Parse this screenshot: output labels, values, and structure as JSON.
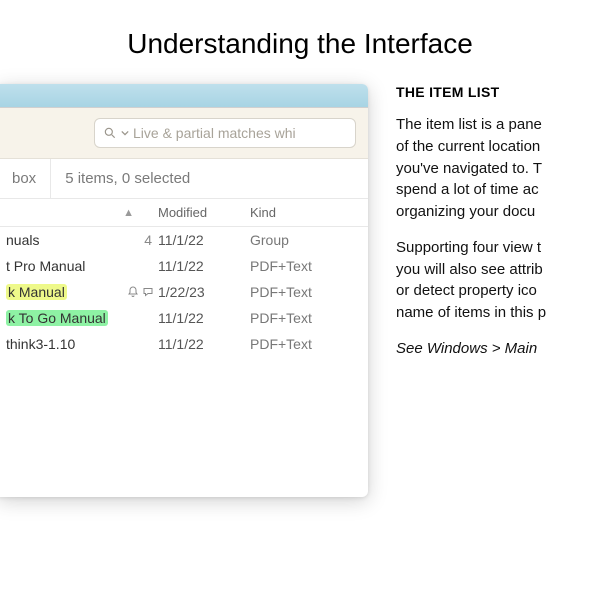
{
  "page": {
    "title": "Understanding the Interface"
  },
  "window": {
    "search_placeholder": "Live & partial matches whi",
    "path_segment": "box",
    "status": "5 items, 0 selected",
    "columns": {
      "modified": "Modified",
      "kind": "Kind"
    },
    "rows": [
      {
        "name": "nuals",
        "count": "4",
        "modified": "11/1/22",
        "kind": "Group",
        "hl": null,
        "icons": []
      },
      {
        "name": "t Pro Manual",
        "count": "",
        "modified": "11/1/22",
        "kind": "PDF+Text",
        "hl": null,
        "icons": []
      },
      {
        "name": "k Manual",
        "count": "",
        "modified": "1/22/23",
        "kind": "PDF+Text",
        "hl": "yellow",
        "icons": [
          "bell",
          "comment"
        ]
      },
      {
        "name": "k To Go Manual",
        "count": "",
        "modified": "11/1/22",
        "kind": "PDF+Text",
        "hl": "green",
        "icons": []
      },
      {
        "name": "think3-1.10",
        "count": "",
        "modified": "11/1/22",
        "kind": "PDF+Text",
        "hl": null,
        "icons": []
      }
    ]
  },
  "article": {
    "heading": "THE ITEM LIST",
    "p1a": "The item list is a pane",
    "p1b": "of the current location",
    "p1c": "you've navigated to. T",
    "p1d": "spend a lot of time ac",
    "p1e": "organizing your docu",
    "p2a": "Supporting four view t",
    "p2b": "you will also see attrib",
    "p2c": "or detect property ico",
    "p2d": "name of items in this p",
    "p3": "See Windows > Main "
  }
}
